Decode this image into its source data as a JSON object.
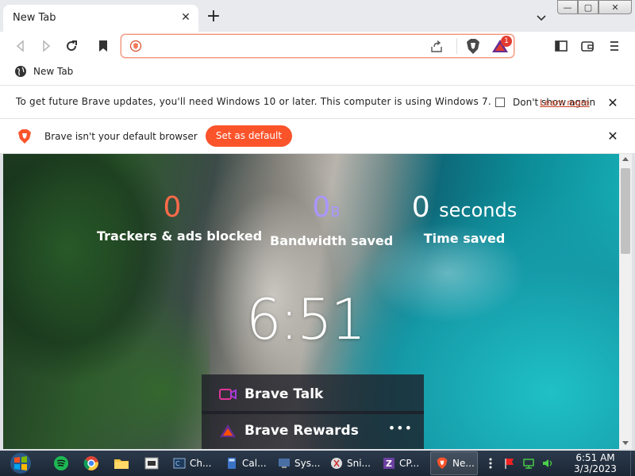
{
  "window": {
    "tab_title": "New Tab",
    "tab_close": "✕",
    "new_tab": "+",
    "controls": {
      "minimize": "—",
      "maximize": "▢",
      "close": "✕"
    }
  },
  "bookmarks": [
    {
      "label": "New Tab"
    }
  ],
  "infobar_update": {
    "text": "To get future Brave updates, you'll need Windows 10 or later. This computer is using Windows 7.",
    "dont_show_label": "Don't show again",
    "learn_more": "Learn more",
    "close": "✕"
  },
  "infobar_default": {
    "text": "Brave isn't your default browser",
    "button": "Set as default",
    "close": "✕"
  },
  "rewards_badge": "1",
  "stats": {
    "trackers": {
      "value": "0",
      "label": "Trackers & ads blocked"
    },
    "bandwidth": {
      "value": "0",
      "unit": "B",
      "label": "Bandwidth saved"
    },
    "time": {
      "value": "0",
      "unit": "seconds",
      "label": "Time saved"
    }
  },
  "clock": "6:51",
  "widgets": {
    "talk": {
      "label": "Brave Talk"
    },
    "rewards": {
      "label": "Brave Rewards",
      "more": "•••"
    }
  },
  "taskbar": {
    "tasks": [
      {
        "label": "Ch..."
      },
      {
        "label": "Cal..."
      },
      {
        "label": "Sys..."
      },
      {
        "label": "Sni..."
      },
      {
        "label": "CP..."
      },
      {
        "label": "Ne..."
      }
    ],
    "time": "6:51 AM",
    "date": "3/3/2023"
  },
  "colors": {
    "brand_orange": "#fb542b",
    "stat_trackers": "#ff6b4a",
    "stat_bandwidth": "#a996ff"
  }
}
